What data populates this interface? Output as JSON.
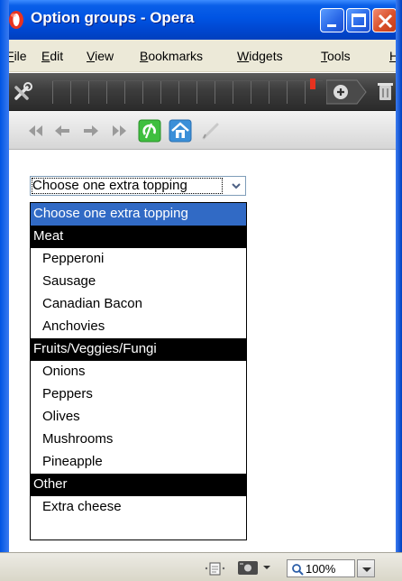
{
  "window": {
    "title": "Option groups - Opera",
    "title_color": "#0054e3"
  },
  "menubar": {
    "items": [
      "File",
      "Edit",
      "View",
      "Bookmarks",
      "Widgets",
      "Tools",
      "H"
    ]
  },
  "select": {
    "value": "Choose one extra topping",
    "options": [
      {
        "kind": "option",
        "label": "Choose one extra topping",
        "selected": true
      },
      {
        "kind": "group",
        "label": "Meat"
      },
      {
        "kind": "option",
        "label": "Pepperoni"
      },
      {
        "kind": "option",
        "label": "Sausage"
      },
      {
        "kind": "option",
        "label": "Canadian Bacon"
      },
      {
        "kind": "option",
        "label": "Anchovies"
      },
      {
        "kind": "group",
        "label": "Fruits/Veggies/Fungi"
      },
      {
        "kind": "option",
        "label": "Onions"
      },
      {
        "kind": "option",
        "label": "Peppers"
      },
      {
        "kind": "option",
        "label": "Olives"
      },
      {
        "kind": "option",
        "label": "Mushrooms"
      },
      {
        "kind": "option",
        "label": "Pineapple"
      },
      {
        "kind": "group",
        "label": "Other"
      },
      {
        "kind": "option",
        "label": "Extra cheese"
      }
    ],
    "highlight_color": "#316ac5"
  },
  "statusbar": {
    "zoom": "100%"
  },
  "icons": {
    "app": "opera-icon",
    "window_buttons": [
      "minimize-icon",
      "maximize-icon",
      "close-icon"
    ],
    "darkbar": [
      "tools-icon",
      "new-tab-icon",
      "trash-icon"
    ],
    "nav": [
      "rewind-icon",
      "back-icon",
      "forward-icon",
      "fast-forward-icon",
      "reload-icon",
      "home-icon",
      "edit-icon"
    ],
    "status": [
      "page-icon",
      "camera-icon",
      "zoom-icon"
    ]
  }
}
